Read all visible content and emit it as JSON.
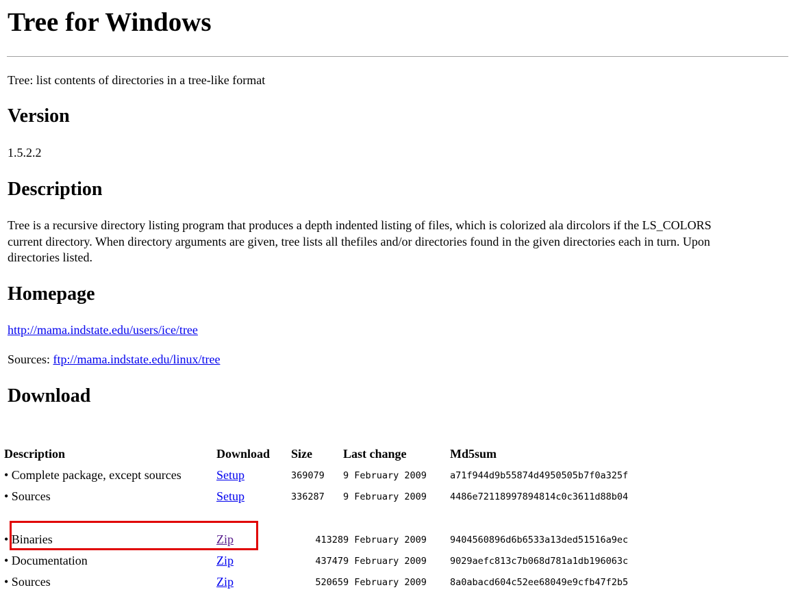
{
  "title": "Tree for Windows",
  "tagline": "Tree: list contents of directories in a tree-like format",
  "sections": {
    "version_heading": "Version",
    "version_value": "1.5.2.2",
    "description_heading": "Description",
    "description_lines": [
      "Tree is a recursive directory listing program that produces a depth indented listing of files, which is colorized ala dircolors if the LS_COLORS",
      "current directory. When directory arguments are given, tree lists all thefiles and/or directories found in the given directories each in turn. Upon",
      "directories listed."
    ],
    "homepage_heading": "Homepage",
    "homepage_url": "http://mama.indstate.edu/users/ice/tree",
    "sources_label": "Sources:",
    "sources_url": "ftp://mama.indstate.edu/linux/tree",
    "download_heading": "Download"
  },
  "download_table": {
    "headers": [
      "Description",
      "Download",
      "Size",
      "Last change",
      "Md5sum"
    ],
    "group1": [
      {
        "description": "• Complete package, except sources",
        "link": "Setup",
        "size": "369079",
        "date": "9 February 2009",
        "md5": "a71f944d9b55874d4950505b7f0a325f"
      },
      {
        "description": "• Sources",
        "link": "Setup",
        "size": "336287",
        "date": "9 February 2009",
        "md5": "4486e72118997894814c0c3611d88b04"
      }
    ],
    "group2": [
      {
        "description": "• Binaries",
        "link": "Zip",
        "size": "41328",
        "date": "9 February 2009",
        "md5": "9404560896d6b6533a13ded51516a9ec"
      },
      {
        "description": "• Documentation",
        "link": "Zip",
        "size": "43747",
        "date": "9 February 2009",
        "md5": "9029aefc813c7b068d781a1db196063c"
      },
      {
        "description": "• Sources",
        "link": "Zip",
        "size": "52065",
        "date": "9 February 2009",
        "md5": "8a0abacd604c52ee68049e9cfb47f2b5"
      }
    ]
  },
  "colors": {
    "link": "#0000ee",
    "visited_link": "#551a8b",
    "highlight": "#e00000"
  }
}
